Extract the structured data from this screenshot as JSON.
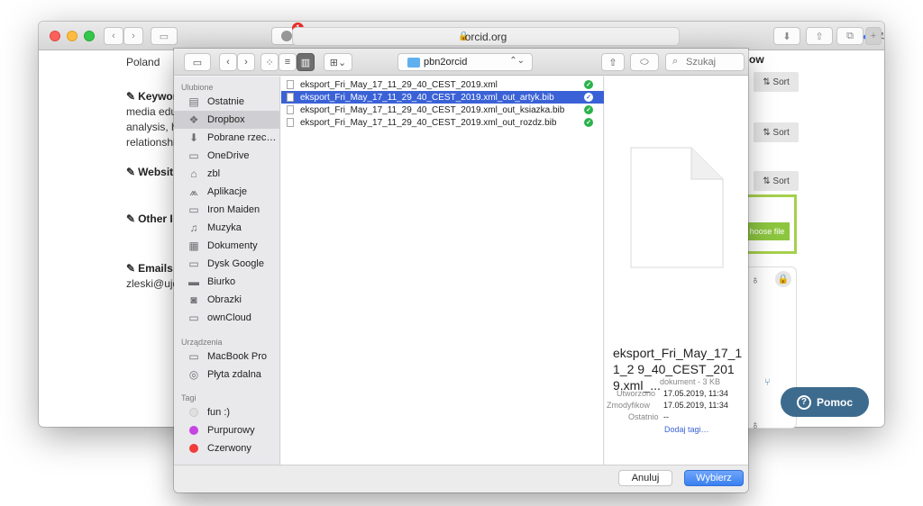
{
  "browser": {
    "address": "orcid.org",
    "extension_badge": "1"
  },
  "page": {
    "country_value": "Poland",
    "keywords_label": "Keywor",
    "keywords_lines": [
      "media edu",
      "analysis, h",
      "relationshi"
    ],
    "websites_label": "Websit",
    "other_ids_label": "Other I",
    "emails_label": "Emails",
    "email_value": "zleski@ujd",
    "sort_label": "Sort",
    "works_heading_fragment": "ow",
    "choose_file_label": "hoose file",
    "help_label": "Pomoc"
  },
  "dialog": {
    "path": "pbn2orcid",
    "search_placeholder": "Szukaj",
    "sidebar": {
      "favorites_header": "Ulubione",
      "favorites": [
        {
          "label": "Ostatnie",
          "icon": "recents-icon"
        },
        {
          "label": "Dropbox",
          "icon": "dropbox-icon"
        },
        {
          "label": "Pobrane rzec…",
          "icon": "downloads-icon"
        },
        {
          "label": "OneDrive",
          "icon": "folder-icon"
        },
        {
          "label": "zbl",
          "icon": "home-icon"
        },
        {
          "label": "Aplikacje",
          "icon": "applications-icon"
        },
        {
          "label": "Iron Maiden",
          "icon": "folder-icon"
        },
        {
          "label": "Muzyka",
          "icon": "music-icon"
        },
        {
          "label": "Dokumenty",
          "icon": "documents-icon"
        },
        {
          "label": "Dysk Google",
          "icon": "folder-icon"
        },
        {
          "label": "Biurko",
          "icon": "desktop-icon"
        },
        {
          "label": "Obrazki",
          "icon": "pictures-icon"
        },
        {
          "label": "ownCloud",
          "icon": "folder-icon"
        }
      ],
      "devices_header": "Urządzenia",
      "devices": [
        {
          "label": "MacBook Pro",
          "icon": "laptop-icon"
        },
        {
          "label": "Płyta zdalna",
          "icon": "disc-icon"
        }
      ],
      "tags_header": "Tagi",
      "tags": [
        {
          "label": "fun :)",
          "color": "#e0e0e0"
        },
        {
          "label": "Purpurowy",
          "color": "#c644e3"
        },
        {
          "label": "Czerwony",
          "color": "#f23b3b"
        }
      ]
    },
    "files": [
      {
        "name": "eksport_Fri_May_17_11_29_40_CEST_2019.xml",
        "selected": false
      },
      {
        "name": "eksport_Fri_May_17_11_29_40_CEST_2019.xml_out_artyk.bib",
        "selected": true
      },
      {
        "name": "eksport_Fri_May_17_11_29_40_CEST_2019.xml_out_ksiazka.bib",
        "selected": false
      },
      {
        "name": "eksport_Fri_May_17_11_29_40_CEST_2019.xml_out_rozdz.bib",
        "selected": false
      }
    ],
    "preview": {
      "name": "eksport_Fri_May_17_11_2 9_40_CEST_2019.xml_...",
      "kind": "dokument - 3 KB",
      "created_label": "Utworzono",
      "created_value": "17.05.2019, 11:34",
      "modified_label": "Zmodyfikow",
      "modified_value": "17.05.2019, 11:34",
      "opened_label": "Ostatnio",
      "opened_value": "--",
      "add_tags": "Dodaj tagi…"
    },
    "cancel_label": "Anuluj",
    "open_label": "Wybierz"
  }
}
